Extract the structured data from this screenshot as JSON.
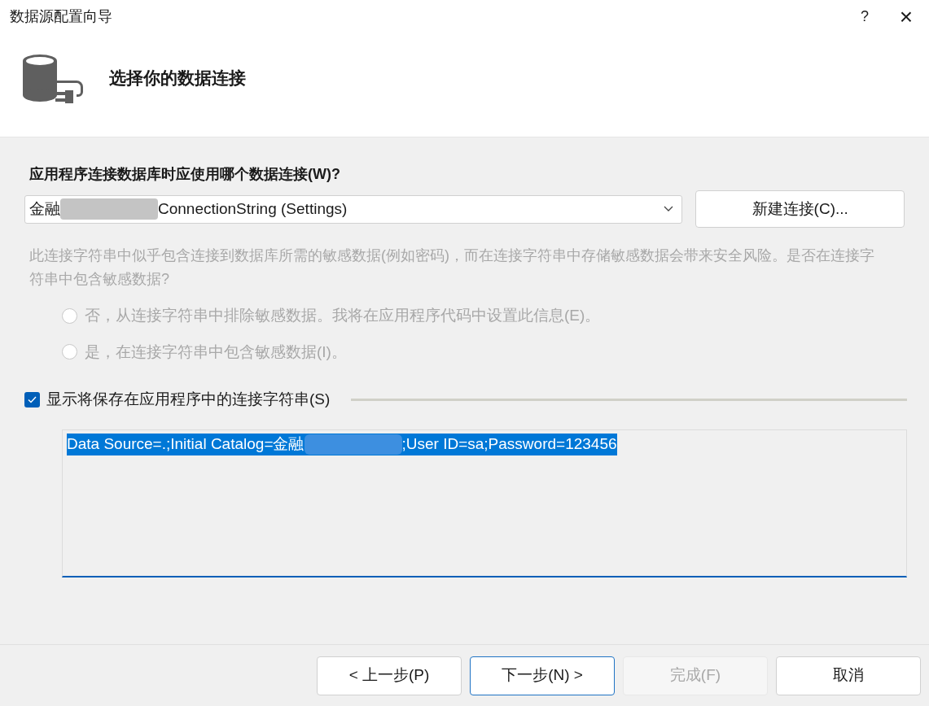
{
  "window": {
    "title": "数据源配置向导",
    "help": "?",
    "close": "×"
  },
  "header": {
    "title": "选择你的数据连接"
  },
  "connection": {
    "label": "应用程序连接数据库时应使用哪个数据连接(W)?",
    "value_parts": [
      "金融",
      "ConnectionString (Settings)"
    ],
    "new_button": "新建连接(C)..."
  },
  "sensitive": {
    "disabled": true,
    "text": "此连接字符串中似乎包含连接到数据库所需的敏感数据(例如密码)，而在连接字符串中存储敏感数据会带来安全风险。是否在连接字符串中包含敏感数据?",
    "options": [
      {
        "label": "否，从连接字符串中排除敏感数据。我将在应用程序代码中设置此信息(E)。",
        "selected": false
      },
      {
        "label": "是，在连接字符串中包含敏感数据(I)。",
        "selected": false
      }
    ]
  },
  "show_string": {
    "label": "显示将保存在应用程序中的连接字符串(S)",
    "checked": true,
    "value_parts": [
      "Data Source=.;Initial Catalog=金融",
      ";User ID=sa;Password=123456"
    ]
  },
  "buttons": [
    {
      "label": "< 上一步(P)",
      "disabled": false,
      "default": false
    },
    {
      "label": "下一步(N) >",
      "disabled": false,
      "default": true
    },
    {
      "label": "完成(F)",
      "disabled": true,
      "default": false
    },
    {
      "label": "取消",
      "disabled": false,
      "default": false
    }
  ]
}
